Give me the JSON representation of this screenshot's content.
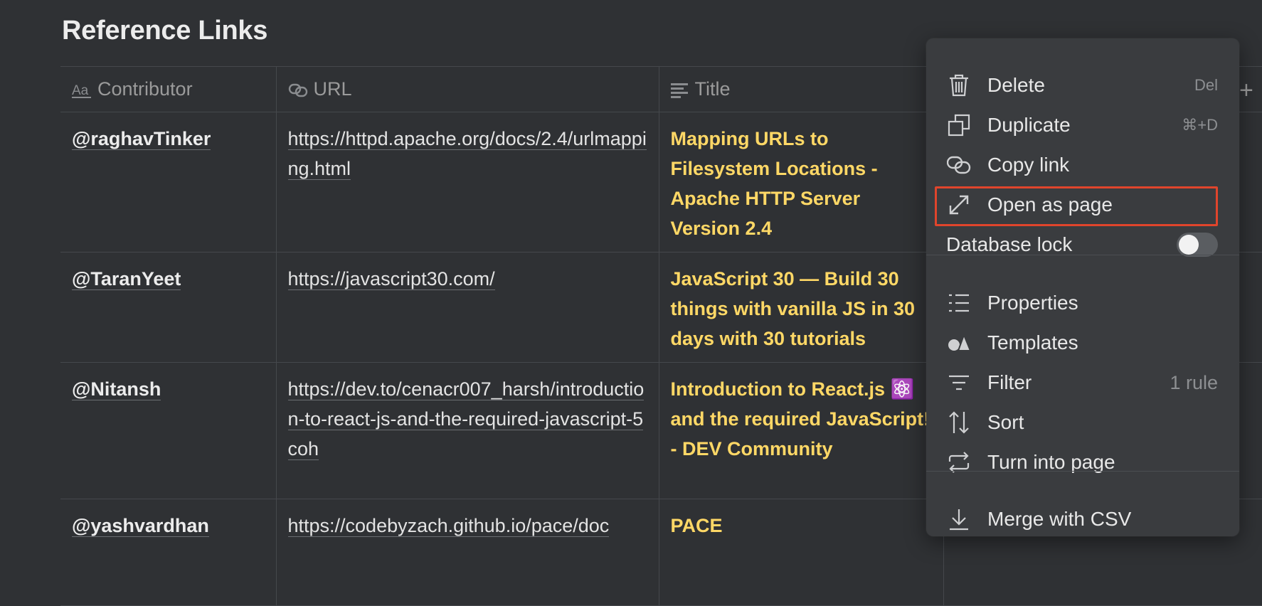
{
  "page": {
    "title": "Reference Links"
  },
  "table": {
    "columns": [
      {
        "label": "Contributor",
        "icon": "text-aa-icon"
      },
      {
        "label": "URL",
        "icon": "link-icon"
      },
      {
        "label": "Title",
        "icon": "text-lines-icon"
      }
    ],
    "rows": [
      {
        "contributor": "@raghavTinker",
        "url": "https://httpd.apache.org/docs/2.4/urlmapping.html",
        "title": "Mapping URLs to Filesystem Locations - Apache HTTP Server Version 2.4"
      },
      {
        "contributor": "@TaranYeet",
        "url": "https://javascript30.com/",
        "title": "JavaScript 30 — Build 30 things with vanilla JS in 30 days with 30 tutorials"
      },
      {
        "contributor": "@Nitansh",
        "url": "https://dev.to/cenacr007_harsh/introduction-to-react-js-and-the-required-javascript-5coh",
        "title": "Introduction to React.js ⚛️ and the required JavaScript!  - DEV Community"
      },
      {
        "contributor": "@yashvardhan",
        "url": "https://codebyzach.github.io/pace/doc",
        "title": "PACE"
      }
    ],
    "add_column_label": "+"
  },
  "menu": {
    "items": [
      {
        "label": "Delete",
        "shortcut": "Del",
        "icon": "trash-icon"
      },
      {
        "label": "Duplicate",
        "shortcut": "⌘+D",
        "icon": "duplicate-icon"
      },
      {
        "label": "Copy link",
        "shortcut": "",
        "icon": "link-icon"
      },
      {
        "label": "Open as page",
        "shortcut": "",
        "icon": "expand-arrow-icon"
      }
    ],
    "lock": {
      "label": "Database lock",
      "on": false
    },
    "items2": [
      {
        "label": "Properties",
        "shortcut": "",
        "icon": "list-icon"
      },
      {
        "label": "Templates",
        "shortcut": "",
        "icon": "shapes-icon"
      },
      {
        "label": "Filter",
        "shortcut": "1 rule",
        "icon": "filter-icon"
      },
      {
        "label": "Sort",
        "shortcut": "",
        "icon": "sort-icon"
      },
      {
        "label": "Turn into page",
        "shortcut": "",
        "icon": "turn-into-icon"
      }
    ],
    "items3": [
      {
        "label": "Merge with CSV",
        "shortcut": "",
        "icon": "download-icon"
      }
    ]
  },
  "colors": {
    "background": "#2f3134",
    "title_text": "#ffd866",
    "highlight": "#e0452c"
  }
}
